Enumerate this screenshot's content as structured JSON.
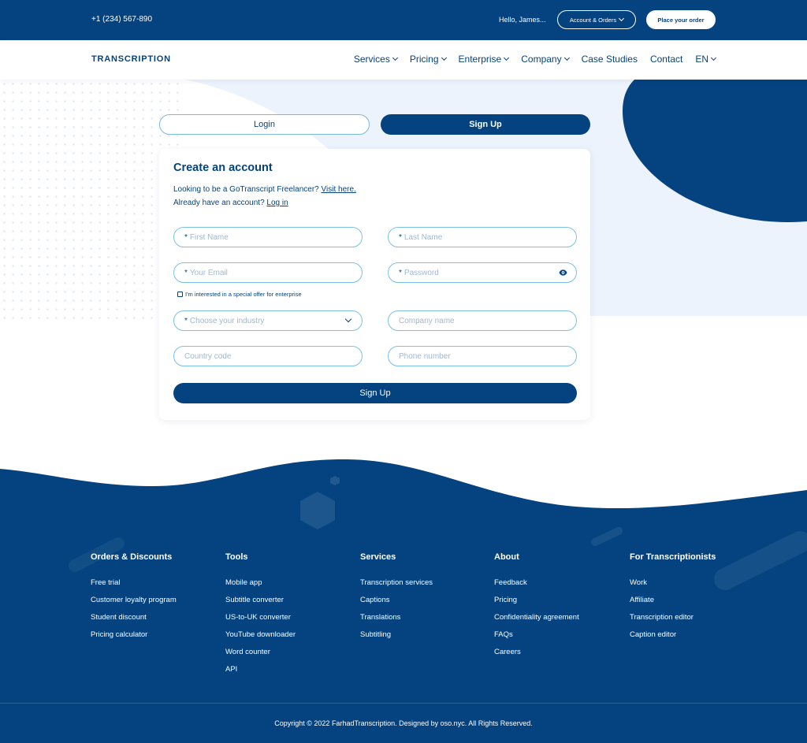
{
  "topbar": {
    "phone": "+1 (234) 567-890",
    "greeting": "Hello, James...",
    "account_label": "Account & Orders",
    "order_label": "Place your order"
  },
  "nav": {
    "logo": "TRANSCRIPTION",
    "items": [
      {
        "label": "Services",
        "has_dropdown": true
      },
      {
        "label": "Pricing",
        "has_dropdown": true
      },
      {
        "label": "Enterprise",
        "has_dropdown": true
      },
      {
        "label": "Company",
        "has_dropdown": true
      },
      {
        "label": "Case Studies",
        "has_dropdown": false
      },
      {
        "label": "Contact",
        "has_dropdown": false
      },
      {
        "label": "EN",
        "has_dropdown": true
      }
    ]
  },
  "tabs": {
    "login": "Login",
    "signup": "Sign Up",
    "active": "signup"
  },
  "form": {
    "title": "Create an account",
    "freelancer_text": "Looking to be a GoTranscript Freelancer?",
    "freelancer_link": "Visit here.",
    "account_text": "Already have an account?",
    "account_link": "Log in",
    "required_mark": "*",
    "first_name": "First Name",
    "last_name": "Last Name",
    "email": "Your Email",
    "password": "Password",
    "enterprise_check": "I'm interested in a special offer for enterprise",
    "industry": "Choose your industry",
    "company": "Company name",
    "country_code": "Country code",
    "phone": "Phone number",
    "submit": "Sign Up"
  },
  "footer": {
    "columns": [
      {
        "title": "Orders & Discounts",
        "links": [
          "Free trial",
          "Customer loyalty program",
          "Student discount",
          "Pricing calculator"
        ]
      },
      {
        "title": "Tools",
        "links": [
          "Mobile app",
          "Subtitle converter",
          "US-to-UK converter",
          "YouTube downloader",
          "Word counter",
          "API"
        ]
      },
      {
        "title": "Services",
        "links": [
          "Transcription services",
          "Captions",
          "Translations",
          "Subtitling"
        ]
      },
      {
        "title": "About",
        "links": [
          "Feedback",
          "Pricing",
          "Confidentiality agreement",
          "FAQs",
          "Careers"
        ]
      },
      {
        "title": "For Transcriptionists",
        "links": [
          "Work",
          "Affiliate",
          "Transcription editor",
          "Caption editor"
        ]
      }
    ],
    "copyright": "Copyright © 2022 FarhadTranscription. Designed by oso.nyc. All Rights Reserved."
  },
  "colors": {
    "primary": "#04437f",
    "field_border": "#7bc0ea",
    "light_bg": "#edf3fd"
  }
}
